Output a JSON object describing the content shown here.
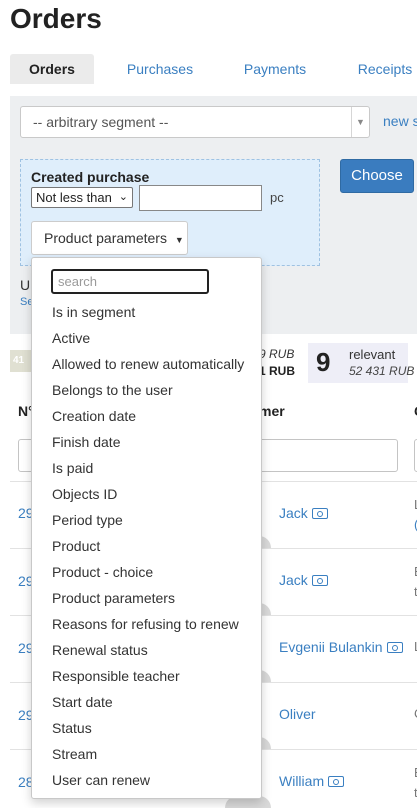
{
  "page_title": "Orders",
  "tabs": [
    "Orders",
    "Purchases",
    "Payments",
    "Receipts"
  ],
  "segment_select": {
    "value": "-- arbitrary segment --",
    "new_link": "new s"
  },
  "condition": {
    "title": "Created purchase",
    "operator": "Not less than",
    "value": "",
    "unit": "pc",
    "params_button": "Product parameters"
  },
  "choose_button": "Choose",
  "partial_u": "Ur",
  "partial_s": "Se",
  "stats": {
    "gray_badge": "41",
    "rub_top": "9 RUB",
    "rub_bottom": "1 RUB",
    "relevant_count": "9",
    "relevant_label": "relevant",
    "relevant_value": "52 431 RUB"
  },
  "table": {
    "col_no": "N°",
    "col_customer": "mer",
    "col_c": "C",
    "rows": [
      {
        "num": "29",
        "name": "Jack",
        "extra_top": "L",
        "extra_bottom": "("
      },
      {
        "num": "29",
        "name": "Jack",
        "extra_top": "E",
        "extra_bottom": "t"
      },
      {
        "num": "29",
        "name": "Evgenii Bulankin",
        "extra_top": "L",
        "extra_bottom": ""
      },
      {
        "num": "29",
        "name": "Oliver",
        "extra_top": "C",
        "extra_bottom": ""
      },
      {
        "num": "28",
        "name": "William",
        "extra_top": "E",
        "extra_bottom": "t"
      }
    ]
  },
  "dropdown": {
    "search_placeholder": "search",
    "items": [
      "Is in segment",
      "Active",
      "Allowed to renew automatically",
      "Belongs to the user",
      "Creation date",
      "Finish date",
      "Is paid",
      "Objects ID",
      "Period type",
      "Product",
      "Product - choice",
      "Product parameters",
      "Reasons for refusing to renew",
      "Renewal status",
      "Responsible teacher",
      "Start date",
      "Status",
      "Stream",
      "User can renew"
    ]
  }
}
